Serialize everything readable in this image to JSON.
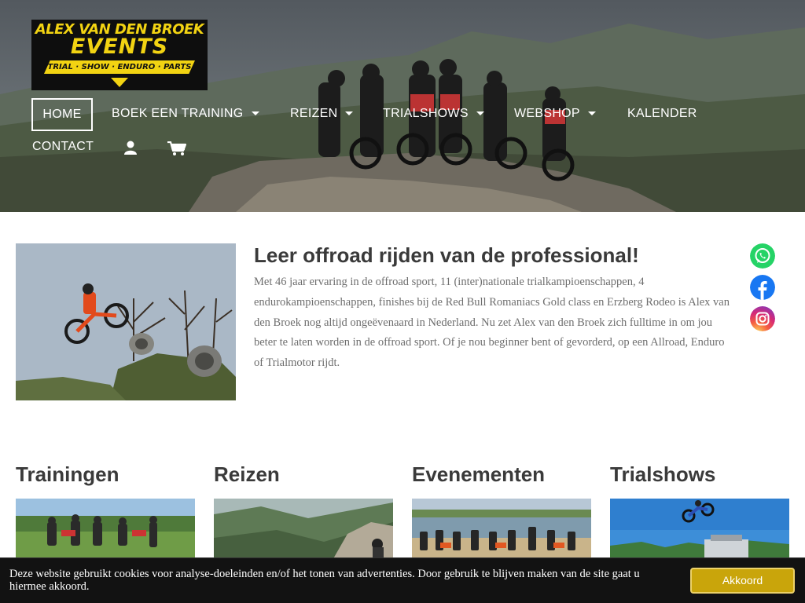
{
  "brand": {
    "line1": "ALEX VAN DEN BROEK",
    "line2": "EVENTS",
    "tagline": "TRIAL · SHOW · ENDURO · PARTS",
    "colors": {
      "yellow": "#f2d312",
      "black": "#0e0e0e"
    }
  },
  "nav": {
    "home": "HOME",
    "boek": "BOEK EEN TRAINING",
    "reizen": "REIZEN",
    "trialshows": "TRIALSHOWS",
    "webshop": "WEBSHOP",
    "kalender": "KALENDER",
    "contact": "CONTACT",
    "icons": [
      "user-icon",
      "cart-icon"
    ]
  },
  "intro": {
    "headline": "Leer offroad rijden van de professional!",
    "body": "Met 46 jaar ervaring in de offroad sport, 11 (inter)nationale trialkampioenschappen, 4 endurokampioenschappen, finishes bij de Red Bull Romaniacs Gold class en Erzberg Rodeo is Alex van den Broek nog altijd ongeëvenaard in Nederland. Nu zet Alex van den Broek zich fulltime in om jou beter te laten worden in de offroad sport. Of je nou beginner bent of gevorderd, op een Allroad, Enduro of Trialmotor rijdt."
  },
  "social": {
    "icons": [
      "whatsapp-icon",
      "facebook-icon",
      "instagram-icon"
    ],
    "colors": {
      "whatsapp": "#25d366",
      "facebook": "#1877f2"
    }
  },
  "sections": {
    "trainingen": "Trainingen",
    "reizen": "Reizen",
    "evenementen": "Evenementen",
    "trialshows": "Trialshows"
  },
  "cookie": {
    "text": "Deze website gebruikt cookies voor analyse-doeleinden en/of het tonen van advertenties. Door gebruik te blijven maken van de site gaat u hiermee akkoord.",
    "button": "Akkoord",
    "button_color": "#c9a50b"
  }
}
